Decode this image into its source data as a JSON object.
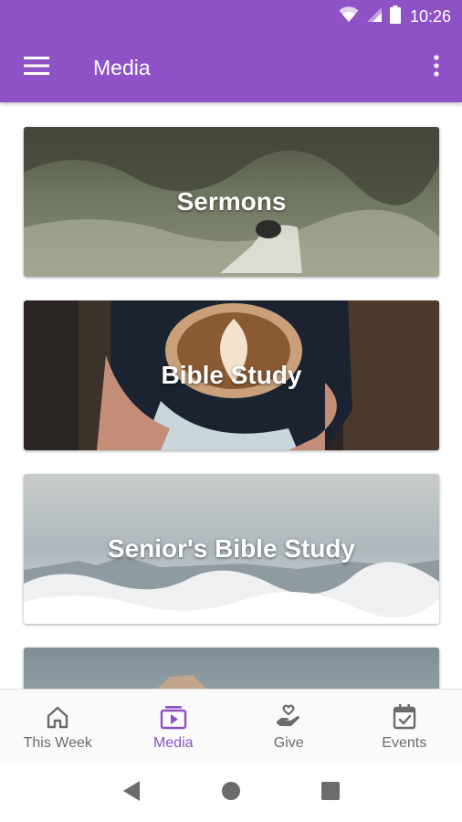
{
  "status_bar": {
    "time": "10:26",
    "icons": [
      "wifi-icon",
      "signal-icon",
      "battery-icon"
    ]
  },
  "app_bar": {
    "title": "Media",
    "menu_icon": "hamburger-menu-icon",
    "overflow_icon": "more-vert-icon",
    "background_color": "#8e52c6"
  },
  "media_cards": [
    {
      "label": "Sermons",
      "image": "lamb-in-field"
    },
    {
      "label": "Bible Study",
      "image": "coffee-cup-in-hands"
    },
    {
      "label": "Senior's Bible Study",
      "image": "clouds-above-mountains"
    },
    {
      "label": "",
      "image": "mountain-peaks"
    }
  ],
  "bottom_nav": {
    "items": [
      {
        "label": "This Week",
        "icon": "home-icon",
        "active": false
      },
      {
        "label": "Media",
        "icon": "video-library-icon",
        "active": true
      },
      {
        "label": "Give",
        "icon": "hand-heart-icon",
        "active": false
      },
      {
        "label": "Events",
        "icon": "calendar-check-icon",
        "active": false
      }
    ],
    "active_color": "#8e52c6",
    "inactive_color": "#6b6b6b"
  },
  "system_nav": {
    "buttons": [
      "back-icon",
      "home-circle-icon",
      "recents-square-icon"
    ]
  }
}
